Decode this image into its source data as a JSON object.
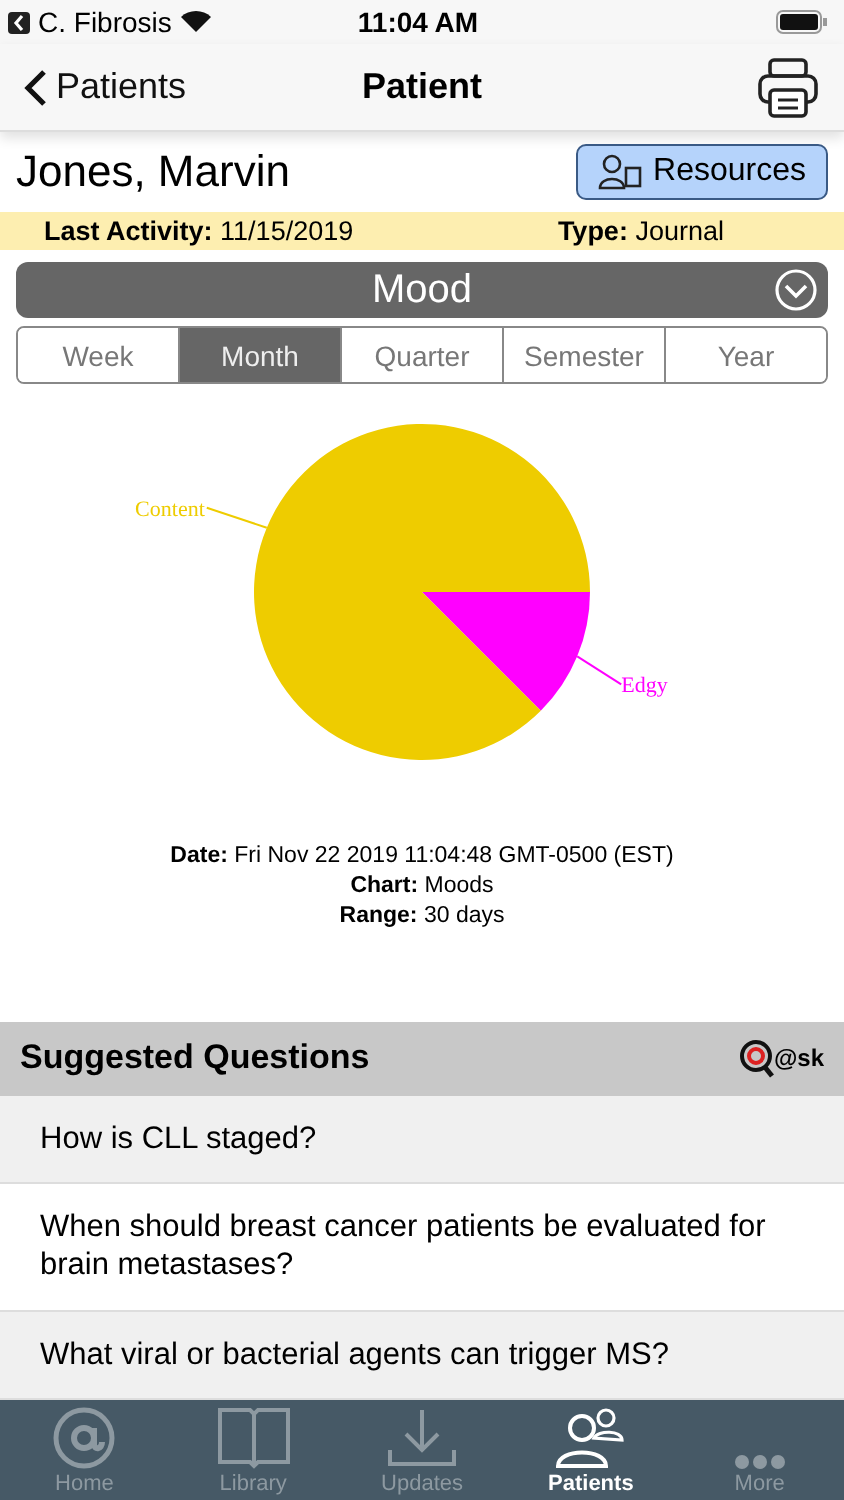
{
  "status_bar": {
    "back_app": "C. Fibrosis",
    "time": "11:04 AM"
  },
  "nav": {
    "back": "Patients",
    "title": "Patient"
  },
  "patient": {
    "name": "Jones, Marvin",
    "resources_button": "Resources"
  },
  "activity": {
    "last_label": "Last Activity:",
    "last_value": "11/15/2019",
    "type_label": "Type:",
    "type_value": "Journal"
  },
  "chart_selector": {
    "title": "Mood"
  },
  "ranges": [
    {
      "label": "Week",
      "selected": false
    },
    {
      "label": "Month",
      "selected": true
    },
    {
      "label": "Quarter",
      "selected": false
    },
    {
      "label": "Semester",
      "selected": false
    },
    {
      "label": "Year",
      "selected": false
    }
  ],
  "chart": {
    "slices": [
      {
        "color": "#eecc00"
      },
      {
        "color": "#ff00ff"
      }
    ],
    "chart_data": {
      "type": "pie",
      "categories": [
        "Content",
        "Edgy"
      ],
      "values": [
        0.875,
        0.125
      ]
    }
  },
  "info": [
    {
      "label": "Date:",
      "value": "Fri Nov 22 2019 11:04:48 GMT-0500 (EST)"
    },
    {
      "label": "Chart:",
      "value": "Moods"
    },
    {
      "label": "Range:",
      "value": "30 days"
    }
  ],
  "suggested": {
    "title": "Suggested Questions",
    "logo": "@sk",
    "questions": [
      "How is CLL staged?",
      "When should breast cancer patients be evaluated for brain metastases?",
      "What viral or bacterial agents can trigger MS?"
    ]
  },
  "tabs": [
    {
      "label": "Home",
      "kind": "home",
      "selected": false
    },
    {
      "label": "Library",
      "kind": "library",
      "selected": false
    },
    {
      "label": "Updates",
      "kind": "updates",
      "selected": false
    },
    {
      "label": "Patients",
      "kind": "patients",
      "selected": true
    },
    {
      "label": "More",
      "kind": "more",
      "selected": false
    }
  ]
}
